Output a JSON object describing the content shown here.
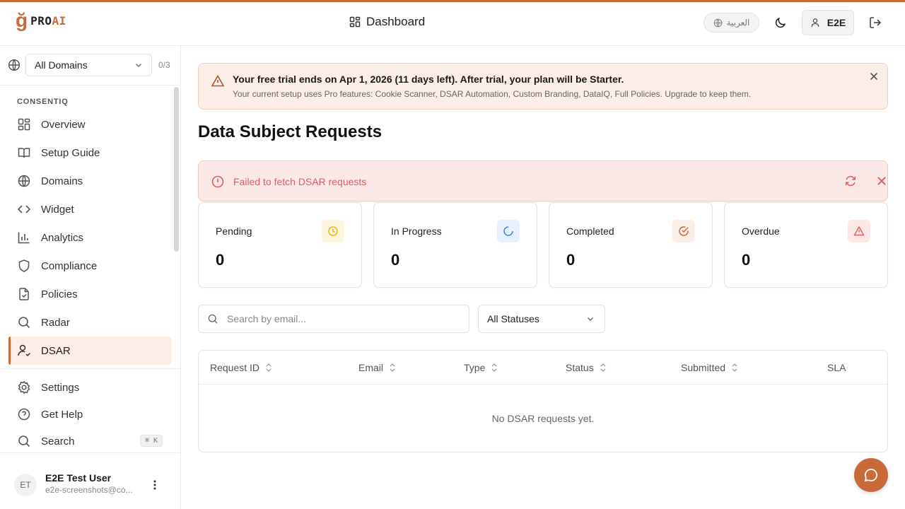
{
  "app": {
    "logo_mark": "ğ",
    "logo_text_a": "PRO",
    "logo_text_b": "AI"
  },
  "header": {
    "title": "Dashboard",
    "language": "العربية",
    "user_label": "E2E"
  },
  "sidebar": {
    "domain_select": "All Domains",
    "domain_count": "0/3",
    "section_label": "CONSENTIQ",
    "items": [
      {
        "label": "Overview",
        "icon": "overview-icon"
      },
      {
        "label": "Setup Guide",
        "icon": "book-icon"
      },
      {
        "label": "Domains",
        "icon": "globe-icon"
      },
      {
        "label": "Widget",
        "icon": "code-icon"
      },
      {
        "label": "Analytics",
        "icon": "chart-icon"
      },
      {
        "label": "Compliance",
        "icon": "shield-icon"
      },
      {
        "label": "Policies",
        "icon": "file-check-icon"
      },
      {
        "label": "Radar",
        "icon": "search-icon"
      },
      {
        "label": "DSAR",
        "icon": "user-check-icon",
        "active": true
      }
    ],
    "bottom_items": [
      {
        "label": "Settings",
        "icon": "gear-icon"
      },
      {
        "label": "Get Help",
        "icon": "help-icon"
      },
      {
        "label": "Search",
        "icon": "search-icon",
        "shortcut": "⌘ K"
      }
    ],
    "user": {
      "initials": "ET",
      "name": "E2E Test User",
      "email": "e2e-screenshots@co..."
    }
  },
  "trial_banner": {
    "title": "Your free trial ends on Apr 1, 2026 (11 days left). After trial, your plan will be Starter.",
    "subtitle": "Your current setup uses Pro features: Cookie Scanner, DSAR Automation, Custom Branding, DataIQ, Full Policies. Upgrade to keep them."
  },
  "page_title": "Data Subject Requests",
  "error_banner": {
    "message": "Failed to fetch DSAR requests"
  },
  "stats": [
    {
      "label": "Pending",
      "value": "0",
      "icon": "clock-icon",
      "color": "#eab308",
      "bg": "#fdf6dc"
    },
    {
      "label": "In Progress",
      "value": "0",
      "icon": "spinner-icon",
      "color": "#3b82f6",
      "bg": "#e8f0fd"
    },
    {
      "label": "Completed",
      "value": "0",
      "icon": "check-circle-icon",
      "color": "#c96a3a",
      "bg": "#fbeee6"
    },
    {
      "label": "Overdue",
      "value": "0",
      "icon": "alert-triangle-icon",
      "color": "#e05c5c",
      "bg": "#fde8e8"
    }
  ],
  "filters": {
    "search_placeholder": "Search by email...",
    "status_select": "All Statuses"
  },
  "table": {
    "columns": [
      "Request ID",
      "Email",
      "Type",
      "Status",
      "Submitted",
      "SLA"
    ],
    "empty_message": "No DSAR requests yet."
  },
  "colors": {
    "accent": "#c96a3a",
    "error": "#e05c5c"
  }
}
